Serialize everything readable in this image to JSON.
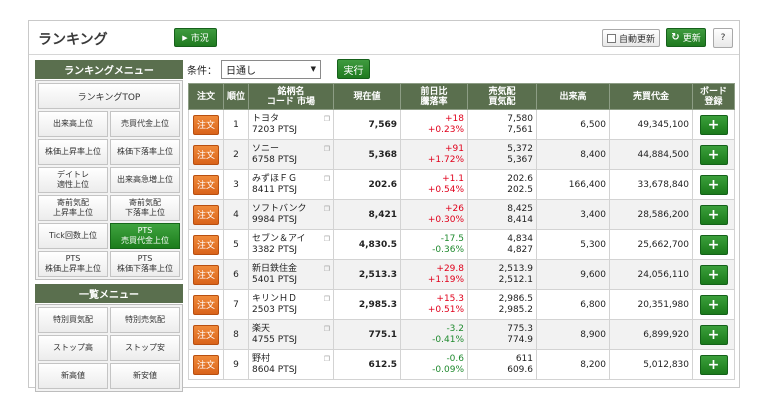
{
  "header": {
    "title": "ランキング",
    "market_button": "市況",
    "auto_update_label": "自動更新",
    "update_button": "更新",
    "help_button": "?"
  },
  "sidebar": {
    "ranking_menu_title": "ランキングメニュー",
    "ranking_top": "ランキングTOP",
    "ranking_items": [
      {
        "label": "出来高上位"
      },
      {
        "label": "売買代金上位"
      },
      {
        "label": "株価上昇率上位"
      },
      {
        "label": "株価下落率上位"
      },
      {
        "label": "デイトレ\n適性上位"
      },
      {
        "label": "出来高急増上位"
      },
      {
        "label": "寄前気配\n上昇率上位"
      },
      {
        "label": "寄前気配\n下落率上位"
      },
      {
        "label": "Tick回数上位"
      },
      {
        "label": "PTS\n売買代金上位"
      },
      {
        "label": "PTS\n株価上昇率上位"
      },
      {
        "label": "PTS\n株価下落率上位"
      }
    ],
    "list_menu_title": "一覧メニュー",
    "list_items": [
      {
        "label": "特別買気配"
      },
      {
        "label": "特別売気配"
      },
      {
        "label": "ストップ高"
      },
      {
        "label": "ストップ安"
      },
      {
        "label": "新高値"
      },
      {
        "label": "新安値"
      }
    ]
  },
  "filter": {
    "condition_label": "条件：",
    "selected": "日通し",
    "run_button": "実行"
  },
  "table": {
    "headers": {
      "order": "注文",
      "rank": "順位",
      "name": "銘柄名\nコード 市場",
      "price": "現在値",
      "change": "前日比\n騰落率",
      "quote": "売気配\n買気配",
      "volume": "出来高",
      "value": "売買代金",
      "board": "ボード\n登録"
    },
    "order_label": "注文",
    "add_label": "+",
    "rows": [
      {
        "rank": "1",
        "name": "トヨタ",
        "code": "7203 PTSJ",
        "price": "7,569",
        "change": "+18",
        "rate": "+0.23%",
        "dir": "up",
        "ask": "7,580",
        "bid": "7,561",
        "volume": "6,500",
        "value": "49,345,100"
      },
      {
        "rank": "2",
        "name": "ソニー",
        "code": "6758 PTSJ",
        "price": "5,368",
        "change": "+91",
        "rate": "+1.72%",
        "dir": "up",
        "ask": "5,372",
        "bid": "5,367",
        "volume": "8,400",
        "value": "44,884,500"
      },
      {
        "rank": "3",
        "name": "みずほＦＧ",
        "code": "8411 PTSJ",
        "price": "202.6",
        "change": "+1.1",
        "rate": "+0.54%",
        "dir": "up",
        "ask": "202.6",
        "bid": "202.5",
        "volume": "166,400",
        "value": "33,678,840"
      },
      {
        "rank": "4",
        "name": "ソフトバンク",
        "code": "9984 PTSJ",
        "price": "8,421",
        "change": "+26",
        "rate": "+0.30%",
        "dir": "up",
        "ask": "8,425",
        "bid": "8,414",
        "volume": "3,400",
        "value": "28,586,200"
      },
      {
        "rank": "5",
        "name": "セブン＆アイ",
        "code": "3382 PTSJ",
        "price": "4,830.5",
        "change": "-17.5",
        "rate": "-0.36%",
        "dir": "dn",
        "ask": "4,834",
        "bid": "4,827",
        "volume": "5,300",
        "value": "25,662,700"
      },
      {
        "rank": "6",
        "name": "新日鉄住金",
        "code": "5401 PTSJ",
        "price": "2,513.3",
        "change": "+29.8",
        "rate": "+1.19%",
        "dir": "up",
        "ask": "2,513.9",
        "bid": "2,512.1",
        "volume": "9,600",
        "value": "24,056,110"
      },
      {
        "rank": "7",
        "name": "キリンＨＤ",
        "code": "2503 PTSJ",
        "price": "2,985.3",
        "change": "+15.3",
        "rate": "+0.51%",
        "dir": "up",
        "ask": "2,986.5",
        "bid": "2,985.2",
        "volume": "6,800",
        "value": "20,351,980"
      },
      {
        "rank": "8",
        "name": "楽天",
        "code": "4755 PTSJ",
        "price": "775.1",
        "change": "-3.2",
        "rate": "-0.41%",
        "dir": "dn",
        "ask": "775.3",
        "bid": "774.9",
        "volume": "8,900",
        "value": "6,899,920"
      },
      {
        "rank": "9",
        "name": "野村",
        "code": "8604 PTSJ",
        "price": "612.5",
        "change": "-0.6",
        "rate": "-0.09%",
        "dir": "dn",
        "ask": "611",
        "bid": "609.6",
        "volume": "8,200",
        "value": "5,012,830"
      }
    ]
  }
}
